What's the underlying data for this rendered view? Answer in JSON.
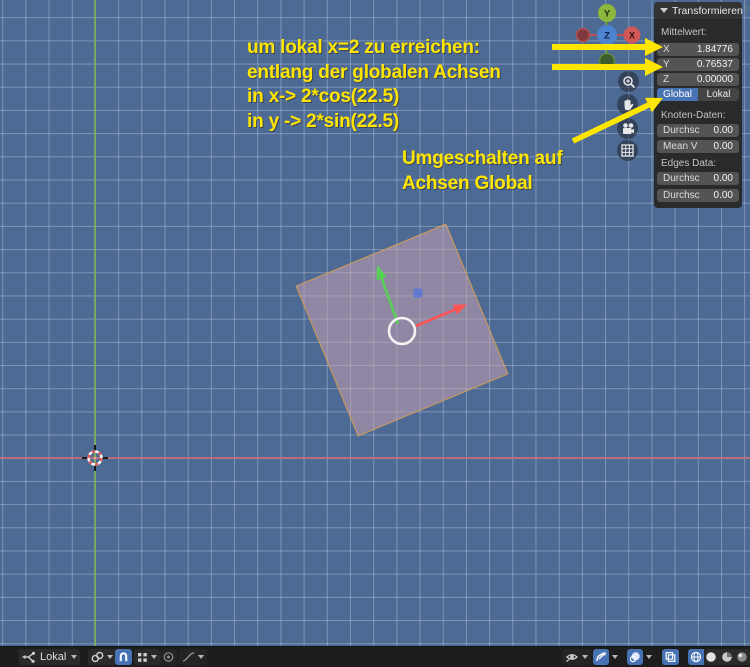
{
  "annotations": {
    "calc_lines": [
      "um lokal x=2 zu erreichen:",
      "entlang der globalen Achsen",
      "in x-> 2*cos(22.5)",
      "in y -> 2*sin(22.5)"
    ],
    "switch_note_lines": [
      "Umgeschalten auf",
      "Achsen Global"
    ],
    "color": "#FFE600"
  },
  "sidebar": {
    "title": "Transformieren",
    "grip": "⠿",
    "median": {
      "label": "Mittelwert:",
      "fields": [
        {
          "axis": "X",
          "value": "1.84776"
        },
        {
          "axis": "Y",
          "value": "0.76537"
        },
        {
          "axis": "Z",
          "value": "0.00000"
        }
      ]
    },
    "orientation": {
      "options": [
        "Global",
        "Lokal"
      ],
      "selected": "Global"
    },
    "vertex": {
      "label": "Knoten-Daten:",
      "fields": [
        {
          "name": "Durchsc",
          "value": "0.00"
        },
        {
          "name": "Mean V",
          "value": "0.00"
        }
      ]
    },
    "edges": {
      "label": "Edges Data:",
      "fields": [
        {
          "name": "Durchsc",
          "value": "0.00"
        },
        {
          "name": "Durchsc",
          "value": "0.00"
        }
      ]
    }
  },
  "nav_gizmo": {
    "x_label": "X",
    "y_label": "Y",
    "z_label": "Z"
  },
  "footer": {
    "orientation_label": "Lokal"
  },
  "icons": {
    "view-zoom": "magnifier-plus",
    "view-move": "hand",
    "view-camera": "movie-camera",
    "view-ortho": "grid",
    "transform-orientation": "axes",
    "pivot-point": "chain-links",
    "snap-toggle": "magnet",
    "snap-target": "dot-grid",
    "proportional-editing": "concentric-circles",
    "proportional-falloff": "curve",
    "gizmo-visibility": "eye",
    "show-gizmos": "arc-arrow",
    "show-overlays": "sphere-ring",
    "xray-toggle": "overlap-squares",
    "shading-wireframe": "wire-globe",
    "shading-solid": "sphere",
    "shading-material": "sphere-half",
    "shading-rendered": "sphere-shaded"
  },
  "colors": {
    "viewport_bg": "#4D6A94",
    "accent_blue": "#4772B3",
    "annotation_yellow": "#FFE600",
    "plane_border": "#CE9B55",
    "axis_x_line": "#C96B76",
    "axis_y_line": "#79AE57"
  }
}
